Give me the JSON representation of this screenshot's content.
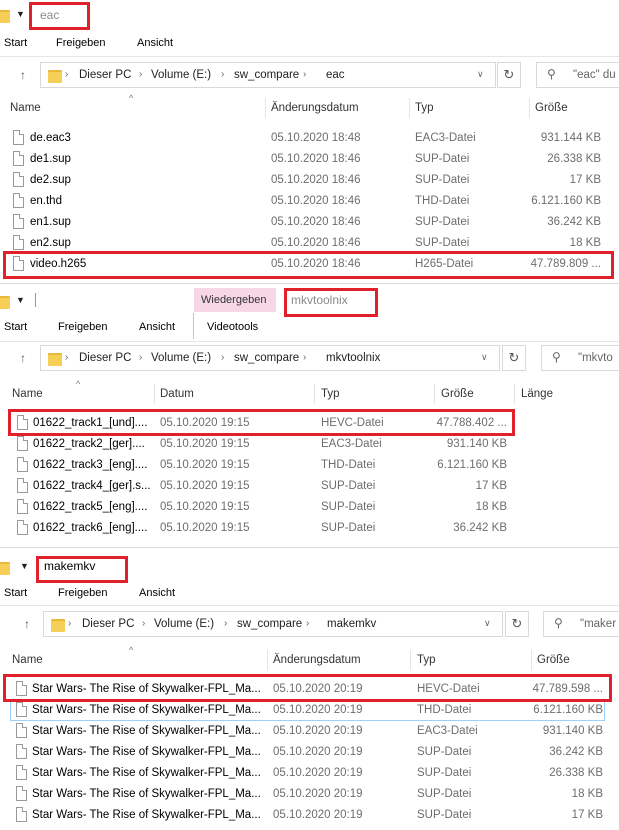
{
  "windows": [
    {
      "title": "eac",
      "tabs": [
        "Start",
        "Freigeben",
        "Ansicht"
      ],
      "breadcrumb": [
        "Dieser PC",
        "Volume (E:)",
        "sw_compare",
        "eac"
      ],
      "search_placeholder": "\"eac\" du",
      "columns": [
        "Name",
        "Änderungsdatum",
        "Typ",
        "Größe"
      ],
      "rows": [
        {
          "name": "de.eac3",
          "date": "05.10.2020 18:48",
          "type": "EAC3-Datei",
          "size": "931.144 KB"
        },
        {
          "name": "de1.sup",
          "date": "05.10.2020 18:46",
          "type": "SUP-Datei",
          "size": "26.338 KB"
        },
        {
          "name": "de2.sup",
          "date": "05.10.2020 18:46",
          "type": "SUP-Datei",
          "size": "17 KB"
        },
        {
          "name": "en.thd",
          "date": "05.10.2020 18:46",
          "type": "THD-Datei",
          "size": "6.121.160 KB"
        },
        {
          "name": "en1.sup",
          "date": "05.10.2020 18:46",
          "type": "SUP-Datei",
          "size": "36.242 KB"
        },
        {
          "name": "en2.sup",
          "date": "05.10.2020 18:46",
          "type": "SUP-Datei",
          "size": "18 KB"
        },
        {
          "name": "video.h265",
          "date": "05.10.2020 18:46",
          "type": "H265-Datei",
          "size": "47.789.809 ..."
        }
      ]
    },
    {
      "title": "mkvtoolnix",
      "tabs": [
        "Start",
        "Freigeben",
        "Ansicht"
      ],
      "context_tab": "Wiedergeben",
      "context_sub": "Videotools",
      "breadcrumb": [
        "Dieser PC",
        "Volume (E:)",
        "sw_compare",
        "mkvtoolnix"
      ],
      "search_placeholder": "\"mkvto",
      "columns": [
        "Name",
        "Datum",
        "Typ",
        "Größe",
        "Länge"
      ],
      "rows": [
        {
          "name": "01622_track1_[und]....",
          "date": "05.10.2020 19:15",
          "type": "HEVC-Datei",
          "size": "47.788.402 ..."
        },
        {
          "name": "01622_track2_[ger]....",
          "date": "05.10.2020 19:15",
          "type": "EAC3-Datei",
          "size": "931.140 KB"
        },
        {
          "name": "01622_track3_[eng]....",
          "date": "05.10.2020 19:15",
          "type": "THD-Datei",
          "size": "6.121.160 KB"
        },
        {
          "name": "01622_track4_[ger].s...",
          "date": "05.10.2020 19:15",
          "type": "SUP-Datei",
          "size": "17 KB"
        },
        {
          "name": "01622_track5_[eng]....",
          "date": "05.10.2020 19:15",
          "type": "SUP-Datei",
          "size": "18 KB"
        },
        {
          "name": "01622_track6_[eng]....",
          "date": "05.10.2020 19:15",
          "type": "SUP-Datei",
          "size": "36.242 KB"
        }
      ]
    },
    {
      "title": "makemkv",
      "tabs": [
        "Start",
        "Freigeben",
        "Ansicht"
      ],
      "breadcrumb": [
        "Dieser PC",
        "Volume (E:)",
        "sw_compare",
        "makemkv"
      ],
      "search_placeholder": "\"maker",
      "columns": [
        "Name",
        "Änderungsdatum",
        "Typ",
        "Größe"
      ],
      "rows": [
        {
          "name": "Star Wars- The Rise of Skywalker-FPL_Ma...",
          "date": "05.10.2020 20:19",
          "type": "HEVC-Datei",
          "size": "47.789.598 ..."
        },
        {
          "name": "Star Wars- The Rise of Skywalker-FPL_Ma...",
          "date": "05.10.2020 20:19",
          "type": "THD-Datei",
          "size": "6.121.160 KB"
        },
        {
          "name": "Star Wars- The Rise of Skywalker-FPL_Ma...",
          "date": "05.10.2020 20:19",
          "type": "EAC3-Datei",
          "size": "931.140 KB"
        },
        {
          "name": "Star Wars- The Rise of Skywalker-FPL_Ma...",
          "date": "05.10.2020 20:19",
          "type": "SUP-Datei",
          "size": "36.242 KB"
        },
        {
          "name": "Star Wars- The Rise of Skywalker-FPL_Ma...",
          "date": "05.10.2020 20:19",
          "type": "SUP-Datei",
          "size": "26.338 KB"
        },
        {
          "name": "Star Wars- The Rise of Skywalker-FPL_Ma...",
          "date": "05.10.2020 20:19",
          "type": "SUP-Datei",
          "size": "18 KB"
        },
        {
          "name": "Star Wars- The Rise of Skywalker-FPL_Ma...",
          "date": "05.10.2020 20:19",
          "type": "SUP-Datei",
          "size": "17 KB"
        }
      ]
    }
  ],
  "icons": {
    "up": "up-arrow-icon",
    "folder": "folder-icon",
    "refresh": "refresh-icon",
    "search": "search-icon"
  },
  "colors": {
    "highlight": "#e0202a",
    "context_tab": "#f7d7e6",
    "selection": "#99d1ff"
  }
}
